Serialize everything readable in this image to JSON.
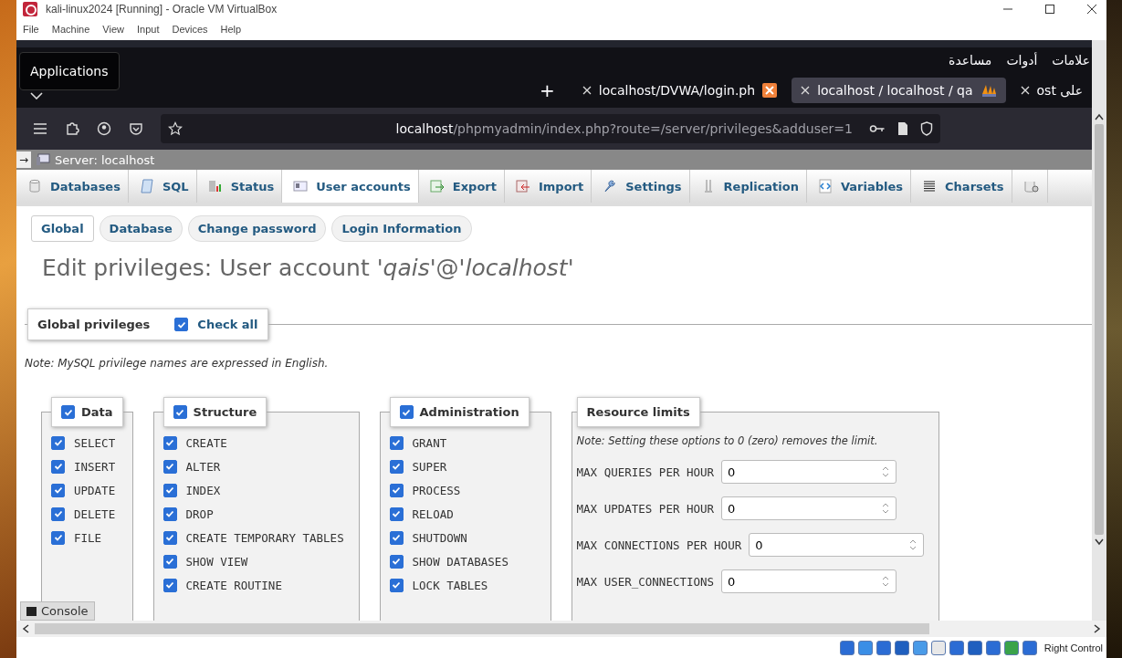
{
  "window": {
    "title": "kali-linux2024 [Running] - Oracle VM VirtualBox",
    "menu": [
      "File",
      "Machine",
      "View",
      "Input",
      "Devices",
      "Help"
    ],
    "status": "Right Control"
  },
  "popup": {
    "label": "Applications"
  },
  "browser": {
    "menu": [
      "علامات",
      "أدوات",
      "مساعدة"
    ],
    "tabs": [
      {
        "label": "localhost/DVWA/login.ph",
        "selected": false
      },
      {
        "label": "localhost / localhost / qa",
        "selected": true
      },
      {
        "label": "ost على",
        "selected": false
      }
    ],
    "new_tab": "+",
    "url": {
      "host": "localhost",
      "path": "/phpmyadmin/index.php?route=/server/privileges&adduser=1"
    }
  },
  "pma": {
    "collapse": "→",
    "breadcrumb": "Server: localhost",
    "tabs": [
      {
        "label": "Databases",
        "selected": false
      },
      {
        "label": "SQL",
        "selected": false
      },
      {
        "label": "Status",
        "selected": false
      },
      {
        "label": "User accounts",
        "selected": true
      },
      {
        "label": "Export",
        "selected": false
      },
      {
        "label": "Import",
        "selected": false
      },
      {
        "label": "Settings",
        "selected": false
      },
      {
        "label": "Replication",
        "selected": false
      },
      {
        "label": "Variables",
        "selected": false
      },
      {
        "label": "Charsets",
        "selected": false
      }
    ],
    "subtabs": [
      {
        "label": "Global",
        "selected": true
      },
      {
        "label": "Database",
        "selected": false
      },
      {
        "label": "Change password",
        "selected": false
      },
      {
        "label": "Login Information",
        "selected": false
      }
    ],
    "heading": "Edit privileges: User account '*qais*'@'*localhost*'",
    "privileges": {
      "legend": "Global privileges",
      "check_all": {
        "label": "Check all",
        "checked": true
      },
      "note": "Note: MySQL privilege names are expressed in English.",
      "groups": [
        {
          "title": "Data",
          "checked": true,
          "items": [
            {
              "label": "SELECT",
              "checked": true
            },
            {
              "label": "INSERT",
              "checked": true
            },
            {
              "label": "UPDATE",
              "checked": true
            },
            {
              "label": "DELETE",
              "checked": true
            },
            {
              "label": "FILE",
              "checked": true
            }
          ]
        },
        {
          "title": "Structure",
          "checked": true,
          "items": [
            {
              "label": "CREATE",
              "checked": true
            },
            {
              "label": "ALTER",
              "checked": true
            },
            {
              "label": "INDEX",
              "checked": true
            },
            {
              "label": "DROP",
              "checked": true
            },
            {
              "label": "CREATE TEMPORARY TABLES",
              "checked": true
            },
            {
              "label": "SHOW VIEW",
              "checked": true
            },
            {
              "label": "CREATE ROUTINE",
              "checked": true
            }
          ]
        },
        {
          "title": "Administration",
          "checked": true,
          "items": [
            {
              "label": "GRANT",
              "checked": true
            },
            {
              "label": "SUPER",
              "checked": true
            },
            {
              "label": "PROCESS",
              "checked": true
            },
            {
              "label": "RELOAD",
              "checked": true
            },
            {
              "label": "SHUTDOWN",
              "checked": true
            },
            {
              "label": "SHOW DATABASES",
              "checked": true
            },
            {
              "label": "LOCK TABLES",
              "checked": true
            }
          ]
        }
      ],
      "resource_limits": {
        "title": "Resource limits",
        "note": "Note: Setting these options to 0 (zero) removes the limit.",
        "fields": [
          {
            "label": "MAX QUERIES PER HOUR",
            "value": "0"
          },
          {
            "label": "MAX UPDATES PER HOUR",
            "value": "0"
          },
          {
            "label": "MAX CONNECTIONS PER HOUR",
            "value": "0"
          },
          {
            "label": "MAX USER_CONNECTIONS",
            "value": "0"
          }
        ]
      }
    },
    "console": "Console"
  }
}
